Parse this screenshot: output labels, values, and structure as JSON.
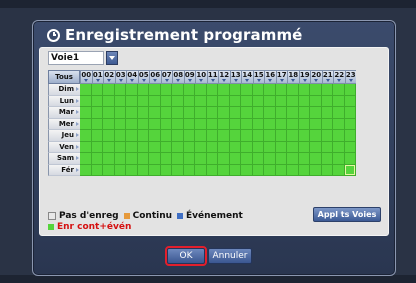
{
  "dialog": {
    "title": "Enregistrement programmé"
  },
  "channel": {
    "selected": "Voie1"
  },
  "schedule": {
    "all_label": "Tous",
    "hours": [
      "00",
      "01",
      "02",
      "03",
      "04",
      "05",
      "06",
      "07",
      "08",
      "09",
      "10",
      "11",
      "12",
      "13",
      "14",
      "15",
      "16",
      "17",
      "18",
      "19",
      "20",
      "21",
      "22",
      "23"
    ],
    "days": [
      "Dim",
      "Lun",
      "Mar",
      "Mer",
      "Jeu",
      "Ven",
      "Sam",
      "Fér"
    ],
    "slot_mode": "Enr cont+évén",
    "slot_color": "#55d43c"
  },
  "legend": {
    "items": [
      {
        "label": "Pas d'enreg",
        "color": "#e8e8e8"
      },
      {
        "label": "Continu",
        "color": "#e69a3c"
      },
      {
        "label": "Événement",
        "color": "#3f6fc4"
      },
      {
        "label": "Enr cont+évén",
        "color": "#55d43c"
      }
    ]
  },
  "buttons": {
    "apply_all": "Appl ts Voies",
    "ok": "OK",
    "cancel": "Annuler"
  }
}
